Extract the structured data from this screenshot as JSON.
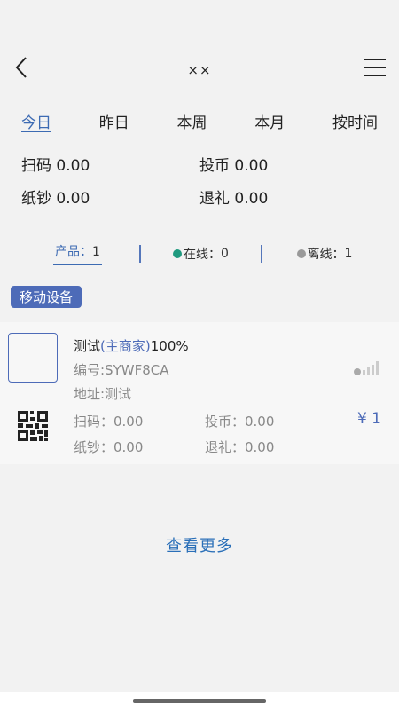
{
  "header": {
    "title": "××"
  },
  "tabs": [
    {
      "label": "今日"
    },
    {
      "label": "昨日"
    },
    {
      "label": "本周"
    },
    {
      "label": "本月"
    },
    {
      "label": "按时间"
    }
  ],
  "summary": {
    "scan": "扫码 0.00",
    "coin": "投币 0.00",
    "cash": "纸钞 0.00",
    "refund": "退礼 0.00"
  },
  "counts": {
    "products_label": "产品：",
    "products_value": "1",
    "online_label": "在线：",
    "online_value": "0",
    "offline_label": "离线：",
    "offline_value": "1",
    "online_color": "#1f9a7f",
    "offline_color": "#999999"
  },
  "badge": {
    "label": "移动设备"
  },
  "device": {
    "name": "测试",
    "role": "(主商家)",
    "share": "100%",
    "code": "编号:SYWF8CA",
    "address": "地址:测试",
    "scan": "扫码：0.00",
    "coin": "投币：0.00",
    "cash": "纸钞：0.00",
    "refund": "退礼：0.00",
    "price": "¥ 1",
    "signal_level": 0
  },
  "more": {
    "label": "查看更多"
  },
  "colors": {
    "accent": "#4d6bb8",
    "link": "#2a6fb8"
  }
}
